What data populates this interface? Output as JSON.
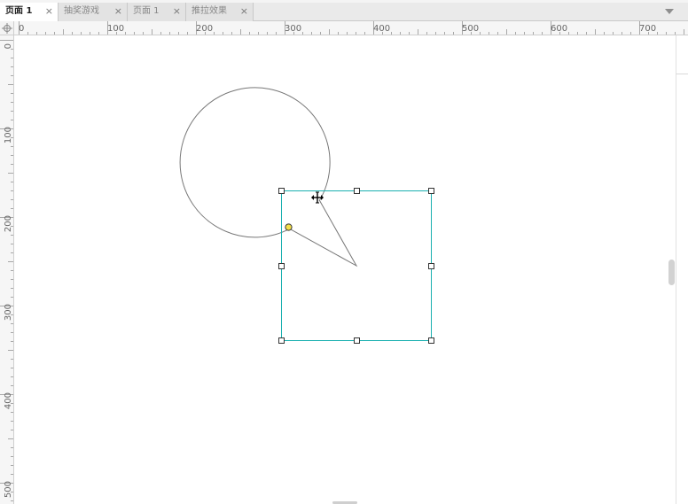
{
  "tabs": [
    {
      "label": "页面 1",
      "active": true
    },
    {
      "label": "抽奖游戏",
      "active": false
    },
    {
      "label": "页面 1",
      "active": false
    },
    {
      "label": "推拉效果",
      "active": false
    }
  ],
  "tab_close_glyph": "×",
  "ruler": {
    "top_labels": [
      "0",
      "100",
      "200",
      "300",
      "400",
      "500",
      "600",
      "700"
    ],
    "left_labels": [
      "0",
      "100",
      "200",
      "300",
      "400",
      "500"
    ]
  },
  "shape": {
    "name": "pie-wedge-shape",
    "stroke_color": "#777777",
    "selection_color": "#1ab0b0",
    "handle_color": "#ffffff",
    "control_point_color": "#f5e04a"
  },
  "icons": {
    "corner": "crosshair-icon",
    "cursor": "move-horizontal-cursor-icon",
    "tab_menu": "chevron-down-icon"
  }
}
